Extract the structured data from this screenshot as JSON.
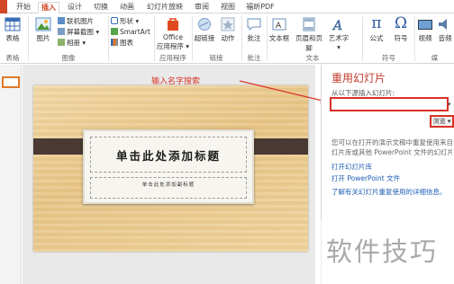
{
  "ribbon_tabs": [
    "开始",
    "插入",
    "设计",
    "切换",
    "动画",
    "幻灯片放映",
    "审阅",
    "视图",
    "福昕PDF"
  ],
  "active_tab": "插入",
  "ribbon": {
    "table": "表格",
    "image": "图片",
    "online_image": "联机图片",
    "screenshot": "屏幕截图",
    "album": "相册",
    "shape": "形状",
    "smartart": "SmartArt",
    "chart": "图表",
    "office_apps_line1": "Office",
    "office_apps_line2": "应用程序",
    "hyperlink": "超链接",
    "action": "动作",
    "comment": "批注",
    "textbox": "文本框",
    "header_footer": "页眉和页脚",
    "wordart": "艺术字",
    "formula": "公式",
    "symbol": "符号",
    "video": "视频",
    "audio": "音频",
    "groups": {
      "table": "表格",
      "image": "图像",
      "apps": "应用程序",
      "links": "链接",
      "comments": "批注",
      "text": "文本",
      "symbols": "符号",
      "media": "媒"
    }
  },
  "slide": {
    "title": "单击此处添加标题",
    "subtitle": "单击此处添加副标题"
  },
  "annotation": "输入名字搜索",
  "reuse_pane": {
    "title": "重用幻灯片",
    "insert_label": "从以下源插入幻灯片:",
    "input_value": "",
    "browse_label": "浏览",
    "desc_line1": "您可以在打开的演示文稿中重复使用来自",
    "desc_line2": "灯片库或其他 PowerPoint 文件的幻灯片",
    "link_open_library": "打开幻灯片库",
    "link_open_file": "打开 PowerPoint 文件",
    "link_learn_more": "了解有关幻灯片重复使用的详细信息。"
  },
  "watermark": "软件技巧",
  "colors": {
    "accent": "#d24726",
    "annotation": "#d8362a",
    "link": "#1e5eb3",
    "band": "#4a3a33"
  }
}
